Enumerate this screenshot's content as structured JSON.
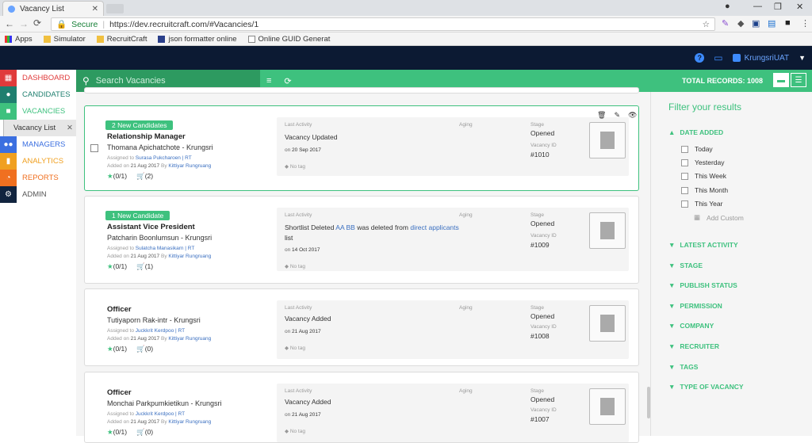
{
  "browser": {
    "tab_title": "Vacancy List",
    "secure": "Secure",
    "url": "https://dev.recruitcraft.com/#Vacancies/1",
    "bookmarks": [
      "Apps",
      "Simulator",
      "RecruitCraft",
      "json formatter online",
      "Online GUID Generat"
    ]
  },
  "header": {
    "username": "KrungsriUAT"
  },
  "nav": {
    "items": [
      {
        "label": "DASHBOARD",
        "color": "#e03b3b"
      },
      {
        "label": "CANDIDATES",
        "color": "#1f7f6f"
      },
      {
        "label": "VACANCIES",
        "color": "#3ec17e"
      },
      {
        "label": "MANAGERS",
        "color": "#3b6fe0"
      },
      {
        "label": "ANALYTICS",
        "color": "#f0a020"
      },
      {
        "label": "REPORTS",
        "color": "#f07020"
      },
      {
        "label": "ADMIN",
        "color": "#12243f"
      }
    ],
    "sub_item": "Vacancy List"
  },
  "toolbar": {
    "search_placeholder": "Search Vacancies",
    "total_records": "TOTAL RECORDS: 1008"
  },
  "cards": [
    {
      "badge": "2 New Candidates",
      "title": "Relationship Manager",
      "company": "Thomana Apichatchote - Krungsri",
      "assigned_label": "Assigned to",
      "assigned": "Surasa Pukcharoen | RT",
      "added_label": "Added on",
      "added": "21 Aug 2017",
      "by_label": "By",
      "by": "Kittiyar Rungruang",
      "stars": "(0/1)",
      "carts": "(2)",
      "activity_label": "Last Activity",
      "activity": "Vacancy Updated",
      "on_label": "on",
      "activity_date": "20 Sep 2017",
      "aging_label": "Aging",
      "stage_label": "Stage",
      "stage": "Opened",
      "vid_label": "Vacancy ID",
      "vid": "#1010",
      "tag": "No tag"
    },
    {
      "badge": "1 New Candidate",
      "title": "Assistant Vice President",
      "company": "Patcharin Boonlumsun - Krungsri",
      "assigned_label": "Assigned to",
      "assigned": "Sulatcha Manasikarn | RT",
      "added_label": "Added on",
      "added": "21 Aug 2017",
      "by_label": "By",
      "by": "Kittiyar Rungruang",
      "stars": "(0/1)",
      "carts": "(1)",
      "activity_label": "Last Activity",
      "activity_a": "Shortlist Deleted",
      "activity_b": "AA BB",
      "activity_c": "was deleted from",
      "activity_d": "direct applicants",
      "activity_e": "list",
      "on_label": "on",
      "activity_date": "14 Oct 2017",
      "aging_label": "Aging",
      "stage_label": "Stage",
      "stage": "Opened",
      "vid_label": "Vacancy ID",
      "vid": "#1009",
      "tag": "No tag"
    },
    {
      "title": "Officer",
      "company": "Tutiyaporn Rak-intr - Krungsri",
      "assigned_label": "Assigned to",
      "assigned": "Juckkrit Kerdpoo | RT",
      "added_label": "Added on",
      "added": "21 Aug 2017",
      "by_label": "By",
      "by": "Kittiyar Rungruang",
      "stars": "(0/1)",
      "carts": "(0)",
      "activity_label": "Last Activity",
      "activity": "Vacancy Added",
      "on_label": "on",
      "activity_date": "21 Aug 2017",
      "aging_label": "Aging",
      "stage_label": "Stage",
      "stage": "Opened",
      "vid_label": "Vacancy ID",
      "vid": "#1008",
      "tag": "No tag"
    },
    {
      "title": "Officer",
      "company": "Monchai Parkpumkietikun - Krungsri",
      "assigned_label": "Assigned to",
      "assigned": "Juckkrit Kerdpoo | RT",
      "added_label": "Added on",
      "added": "21 Aug 2017",
      "by_label": "By",
      "by": "Kittiyar Rungruang",
      "stars": "(0/1)",
      "carts": "(0)",
      "activity_label": "Last Activity",
      "activity": "Vacancy Added",
      "on_label": "on",
      "activity_date": "21 Aug 2017",
      "aging_label": "Aging",
      "stage_label": "Stage",
      "stage": "Opened",
      "vid_label": "Vacancy ID",
      "vid": "#1007",
      "tag": "No tag"
    }
  ],
  "filters": {
    "title": "Filter your results",
    "date_added": "DATE ADDED",
    "date_options": [
      "Today",
      "Yesterday",
      "This Week",
      "This Month",
      "This Year"
    ],
    "add_custom": "Add Custom",
    "sections": [
      "LATEST ACTIVITY",
      "STAGE",
      "PUBLISH STATUS",
      "PERMISSION",
      "COMPANY",
      "RECRUITER",
      "TAGS",
      "TYPE OF VACANCY"
    ]
  }
}
